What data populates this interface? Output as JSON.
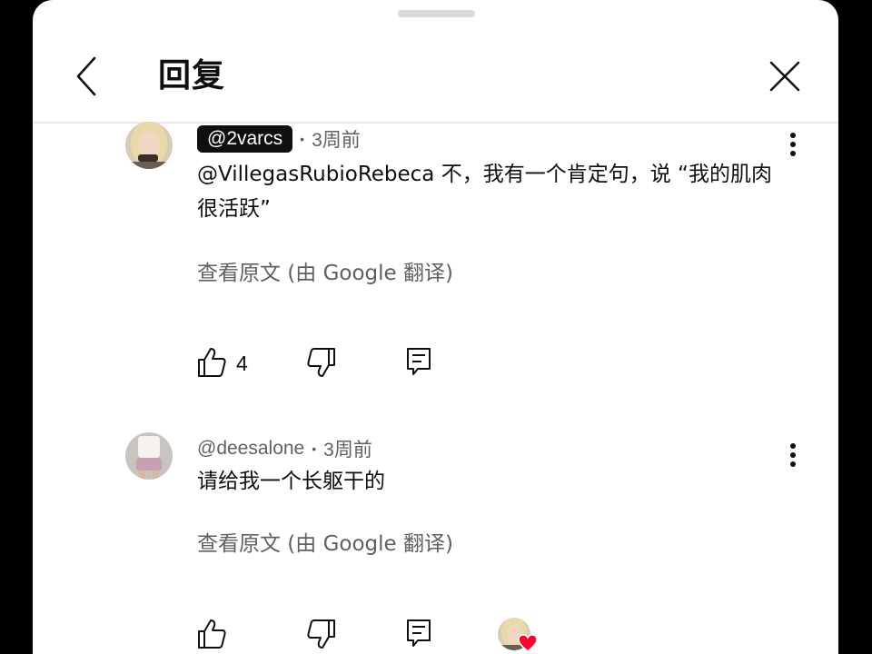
{
  "header": {
    "title": "回复"
  },
  "comments": [
    {
      "handle": "@2varcs",
      "time": "3周前",
      "text": "@VillegasRubioRebeca 不，我有一个肯定句，说 “我的肌肉很活跃”",
      "translate": "查看原文 (由 Google 翻译)",
      "likes": "4"
    },
    {
      "handle": "@deesalone",
      "time": "3周前",
      "text": "请给我一个长躯干的",
      "translate": "查看原文 (由 Google 翻译)"
    }
  ],
  "colors": {
    "heart": "#ff0033",
    "secondary_text": "#606060",
    "pill_bg": "#0f0f0f"
  },
  "icons": [
    "back-icon",
    "close-icon",
    "more-vert-icon",
    "thumb-up-icon",
    "thumb-down-icon",
    "reply-icon",
    "heart-icon"
  ]
}
